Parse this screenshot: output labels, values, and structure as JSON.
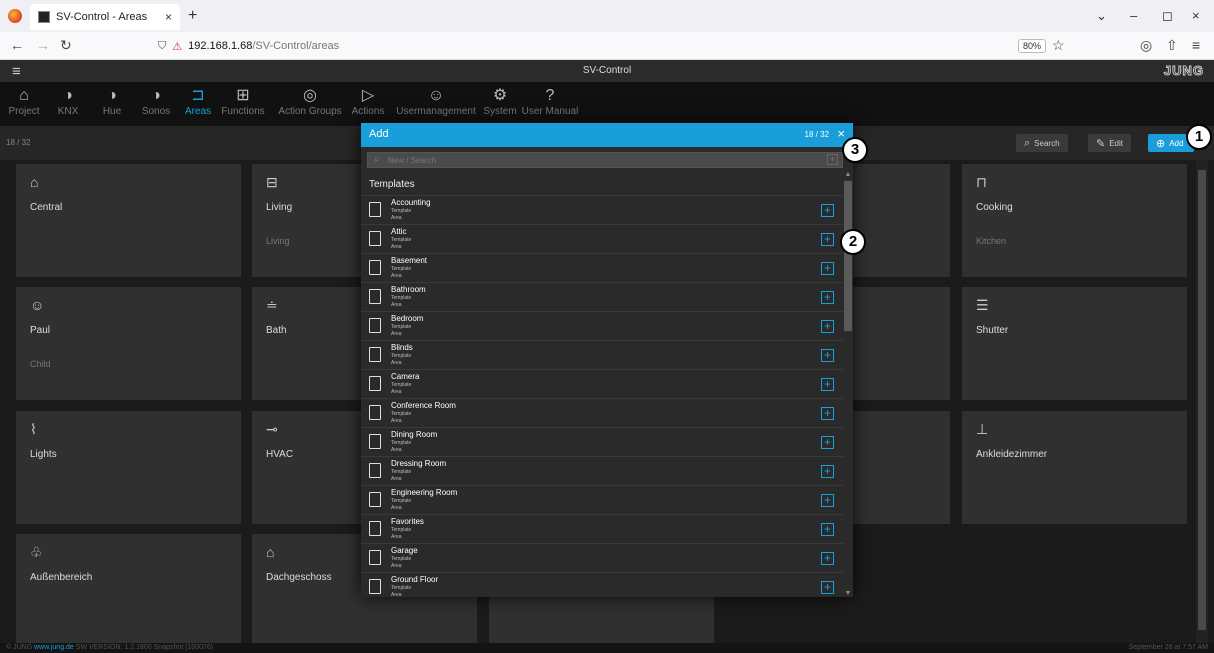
{
  "browser": {
    "tab_title": "SV-Control - Areas",
    "tab_close": "×",
    "new_tab": "+",
    "url_host": "192.168.1.68",
    "url_path": "/SV-Control/areas",
    "zoom": "80%",
    "win_chevron": "⌄",
    "win_min": "–",
    "win_max": "◻",
    "win_close": "×",
    "back": "←",
    "forward": "→",
    "reload": "↻",
    "star": "☆",
    "pocket": "◎",
    "share": "⇧",
    "menu": "≡"
  },
  "app": {
    "menu_icon": "≡",
    "title": "SV-Control",
    "brand": "JUNG"
  },
  "toolbar": {
    "items": [
      {
        "label": "Project",
        "icon": "⌂"
      },
      {
        "label": "KNX",
        "icon": "◑"
      },
      {
        "label": "Hue",
        "icon": "◑"
      },
      {
        "label": "Sonos",
        "icon": "◑"
      },
      {
        "label": "Areas",
        "icon": "⊐"
      },
      {
        "label": "Functions",
        "icon": "⊞"
      },
      {
        "label": "Action Groups",
        "icon": "◎"
      },
      {
        "label": "Actions",
        "icon": "▷"
      },
      {
        "label": "Usermanagement",
        "icon": "☺"
      },
      {
        "label": "System",
        "icon": "⚙"
      },
      {
        "label": "User Manual",
        "icon": "?"
      }
    ],
    "active": "Areas"
  },
  "subbar": {
    "count": "18 / 32",
    "search_label": "Search",
    "search_icon": "⌕",
    "edit_label": "Edit",
    "edit_icon": "✎",
    "add_label": "Add",
    "add_icon": "⊕"
  },
  "tiles": [
    {
      "name": "Central",
      "sub": "",
      "icon": "⌂"
    },
    {
      "name": "Living",
      "sub": "Living",
      "icon": "⊟"
    },
    {
      "name": "Cooking",
      "sub": "Kitchen",
      "icon": "⊓"
    },
    {
      "name": "Paul",
      "sub": "Child",
      "icon": "☺"
    },
    {
      "name": "Bath",
      "sub": "",
      "icon": "≐"
    },
    {
      "name": "Shutter",
      "sub": "",
      "icon": "☰"
    },
    {
      "name": "Lights",
      "sub": "",
      "icon": "⌇"
    },
    {
      "name": "HVAC",
      "sub": "",
      "icon": "⊸"
    },
    {
      "name": "Ankleidezimmer",
      "sub": "",
      "icon": "⊥"
    },
    {
      "name": "Außenbereich",
      "sub": "",
      "icon": "♧"
    },
    {
      "name": "Dachgeschoss",
      "sub": "",
      "icon": "⌂"
    }
  ],
  "dialog": {
    "title": "Add",
    "count": "18 / 32",
    "close": "×",
    "search_placeholder": "New / Search",
    "search_icon": "⌕",
    "search_add": "+",
    "section": "Templates",
    "items": [
      {
        "name": "Accounting",
        "type": "Template",
        "kind": "Area"
      },
      {
        "name": "Attic",
        "type": "Template",
        "kind": "Area"
      },
      {
        "name": "Basement",
        "type": "Template",
        "kind": "Area"
      },
      {
        "name": "Bathroom",
        "type": "Template",
        "kind": "Area"
      },
      {
        "name": "Bedroom",
        "type": "Template",
        "kind": "Area"
      },
      {
        "name": "Blinds",
        "type": "Template",
        "kind": "Area"
      },
      {
        "name": "Camera",
        "type": "Template",
        "kind": "Area"
      },
      {
        "name": "Conference Room",
        "type": "Template",
        "kind": "Area"
      },
      {
        "name": "Dining Room",
        "type": "Template",
        "kind": "Area"
      },
      {
        "name": "Dressing Room",
        "type": "Template",
        "kind": "Area"
      },
      {
        "name": "Engineering Room",
        "type": "Template",
        "kind": "Area"
      },
      {
        "name": "Favorites",
        "type": "Template",
        "kind": "Area"
      },
      {
        "name": "Garage",
        "type": "Template",
        "kind": "Area"
      },
      {
        "name": "Ground Floor",
        "type": "Template",
        "kind": "Area"
      }
    ],
    "add_glyph": "+"
  },
  "footer": {
    "copyright": "© JUNG",
    "link": "www.jung.de",
    "version": "SW VERSION: 1.2.1800 Snapshot (100076)",
    "date": "September 26 at 7:57 AM"
  },
  "callouts": [
    "1",
    "2",
    "3"
  ]
}
